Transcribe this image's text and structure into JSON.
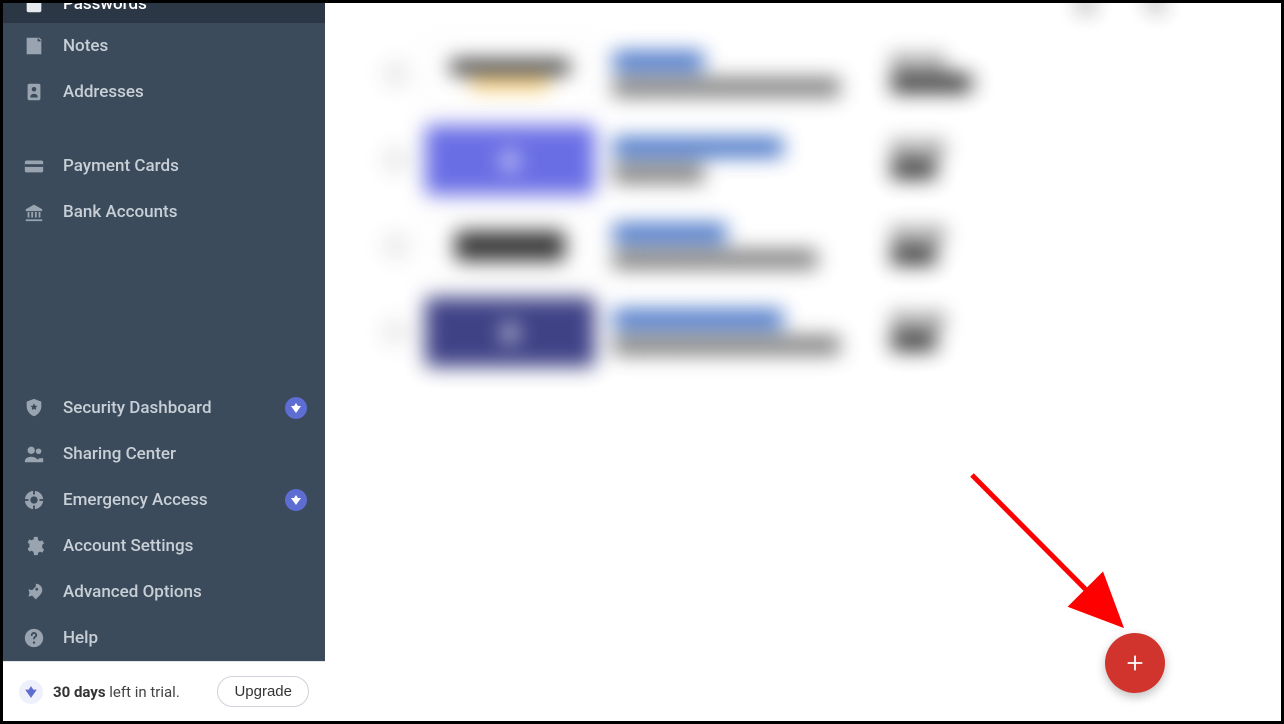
{
  "sidebar": {
    "top_items": [
      {
        "label": "Passwords",
        "icon": "lock-icon",
        "active": true
      },
      {
        "label": "Notes",
        "icon": "note-icon",
        "active": false
      },
      {
        "label": "Addresses",
        "icon": "address-icon",
        "active": false
      }
    ],
    "mid_items": [
      {
        "label": "Payment Cards",
        "icon": "card-icon"
      },
      {
        "label": "Bank Accounts",
        "icon": "bank-icon"
      }
    ],
    "bottom_items": [
      {
        "label": "Security Dashboard",
        "icon": "shield-icon",
        "premium": true
      },
      {
        "label": "Sharing Center",
        "icon": "people-icon",
        "premium": false
      },
      {
        "label": "Emergency Access",
        "icon": "lifering-icon",
        "premium": true
      },
      {
        "label": "Account Settings",
        "icon": "gear-icon",
        "premium": false
      },
      {
        "label": "Advanced Options",
        "icon": "rocket-icon",
        "premium": false
      },
      {
        "label": "Help",
        "icon": "help-icon",
        "premium": false
      }
    ]
  },
  "trial": {
    "bold_text": "30 days",
    "rest_text": " left in trial.",
    "upgrade_label": "Upgrade"
  },
  "fab": {
    "label": "+",
    "name": "add-item"
  },
  "annotation": {
    "arrow_color": "#ff0000"
  }
}
